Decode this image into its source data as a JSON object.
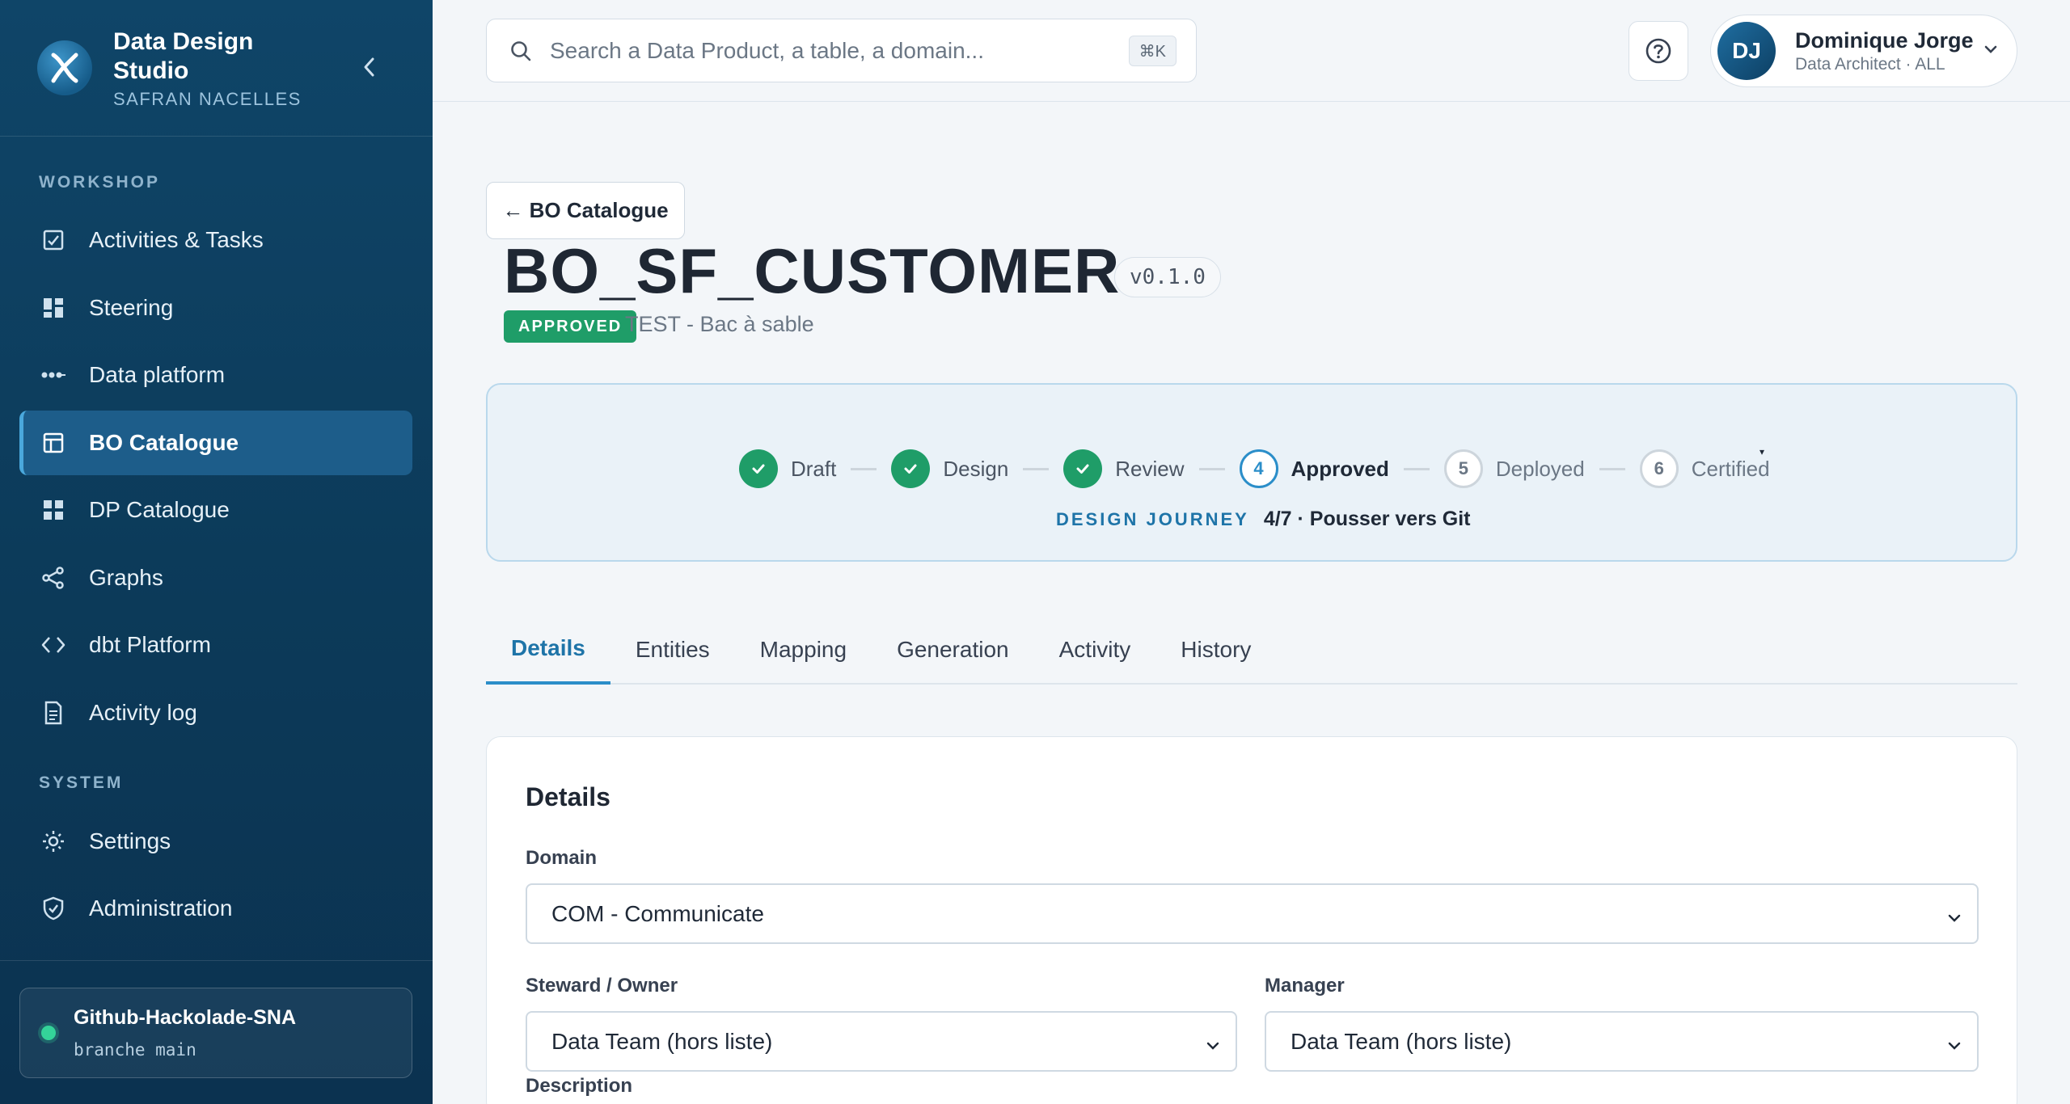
{
  "brand": {
    "title": "Data Design Studio",
    "subtitle": "SAFRAN NACELLES"
  },
  "sidebar": {
    "workshop_label": "WORKSHOP",
    "system_label": "SYSTEM",
    "items": [
      {
        "label": "Activities & Tasks",
        "icon": "tasks-icon"
      },
      {
        "label": "Steering",
        "icon": "dashboard-icon"
      },
      {
        "label": "Data platform",
        "icon": "pipeline-icon"
      },
      {
        "label": "BO Catalogue",
        "icon": "catalogue-icon",
        "active": true
      },
      {
        "label": "DP Catalogue",
        "icon": "grid-icon"
      },
      {
        "label": "Graphs",
        "icon": "share-icon"
      },
      {
        "label": "dbt Platform",
        "icon": "code-icon"
      },
      {
        "label": "Activity log",
        "icon": "document-icon"
      }
    ],
    "system_items": [
      {
        "label": "Settings",
        "icon": "sun-icon"
      },
      {
        "label": "Administration",
        "icon": "shield-icon"
      }
    ],
    "repo": {
      "name": "Github-Hackolade-SNA",
      "branch": "branche main",
      "status_color": "#34d399"
    }
  },
  "search": {
    "placeholder": "Search a Data Product, a table, a domain...",
    "shortcut": "⌘K"
  },
  "user": {
    "initials": "DJ",
    "name": "Dominique Jorge",
    "role": "Data Architect · ALL"
  },
  "page": {
    "back_label": "← BO Catalogue",
    "title": "BO_SF_CUSTOMER",
    "version": "v0.1.0",
    "status": "APPROVED",
    "status_color": "#1f9d68",
    "environment": "TEST - Bac à sable"
  },
  "journey": {
    "steps": [
      {
        "label": "Draft",
        "state": "done"
      },
      {
        "label": "Design",
        "state": "done"
      },
      {
        "label": "Review",
        "state": "done"
      },
      {
        "label": "Approved",
        "state": "current",
        "number": "4"
      },
      {
        "label": "Deployed",
        "state": "todo",
        "number": "5"
      },
      {
        "label": "Certified",
        "state": "todo",
        "number": "6"
      }
    ],
    "label": "DESIGN JOURNEY",
    "progress": "4/7 · Pousser vers Git",
    "caret": "▾"
  },
  "tabs": [
    "Details",
    "Entities",
    "Mapping",
    "Generation",
    "Activity",
    "History"
  ],
  "details": {
    "title": "Details",
    "domain_label": "Domain",
    "domain_value": "COM - Communicate",
    "steward_label": "Steward / Owner",
    "steward_value": "Data Team (hors liste)",
    "manager_label": "Manager",
    "manager_value": "Data Team (hors liste)",
    "description_label": "Description"
  },
  "colors": {
    "sidebar_bg": "#0f4568",
    "accent": "#2b8ec9",
    "success": "#1f9d68"
  }
}
